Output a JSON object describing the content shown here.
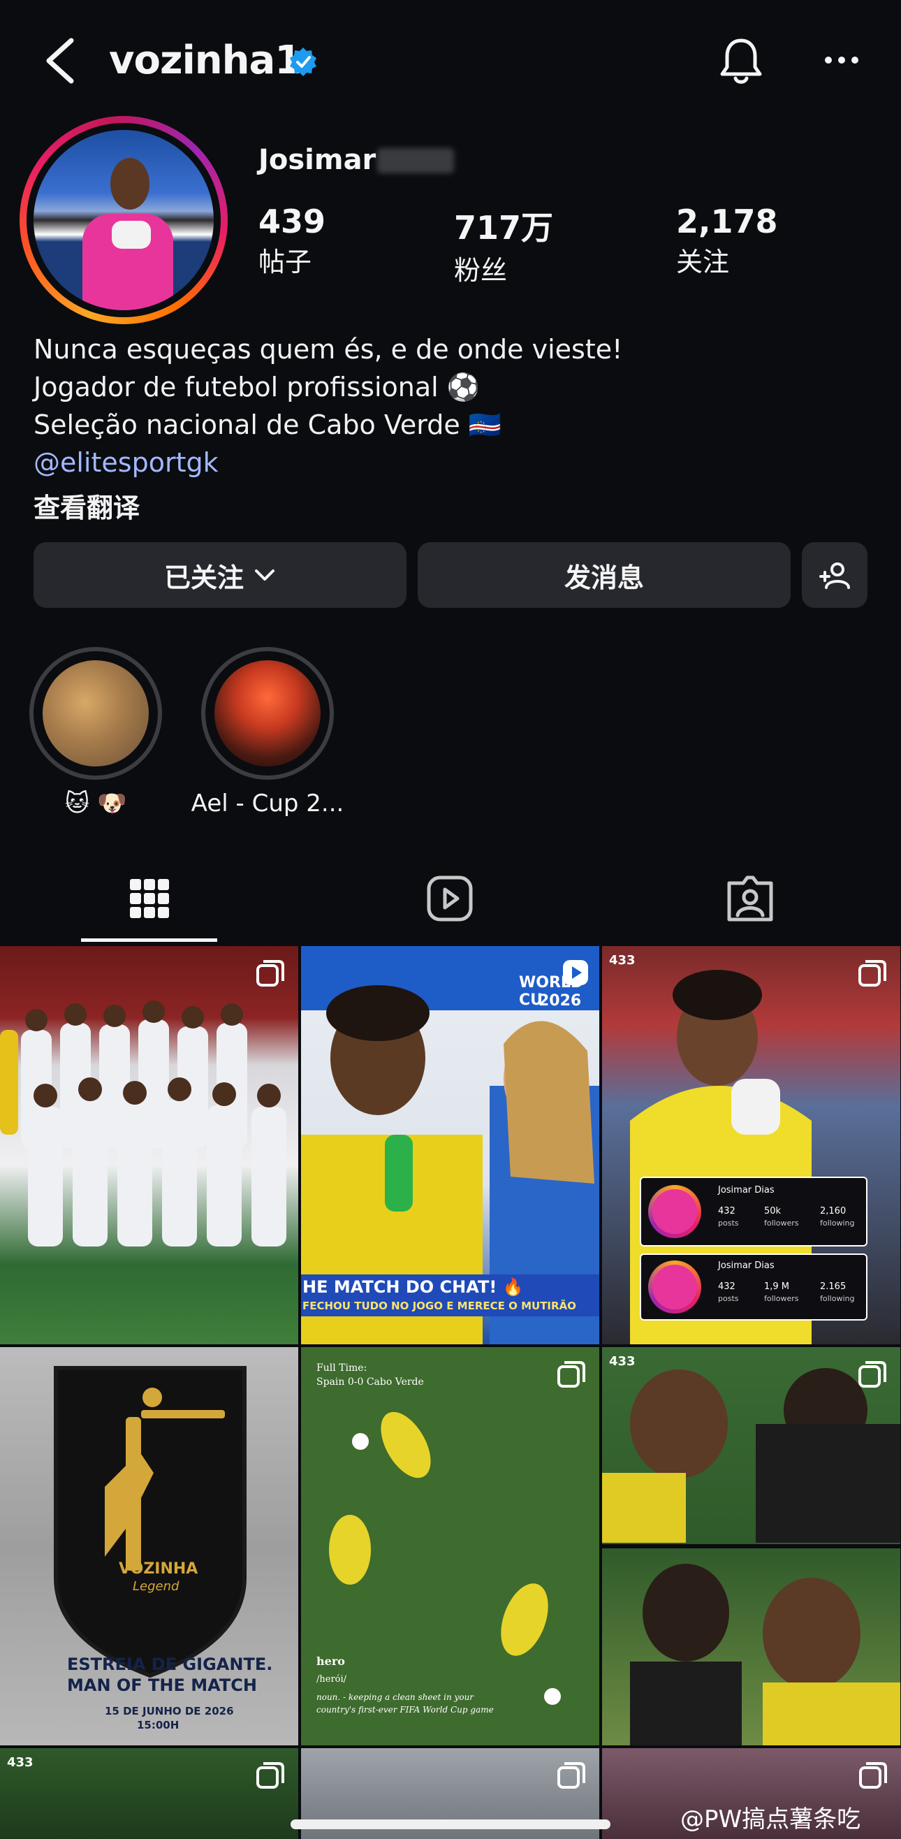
{
  "header": {
    "username": "vozinha1",
    "verified": "verified-badge-icon"
  },
  "profile": {
    "full_name": "Josimar",
    "stats": [
      {
        "value": "439",
        "label": "帖子"
      },
      {
        "value": "717万",
        "label": "粉丝"
      },
      {
        "value": "2,178",
        "label": "关注"
      }
    ],
    "bio_lines": [
      "Nunca esqueças quem és, e de onde vieste!",
      "Jogador de futebol profissional ⚽",
      "Seleção nacional de Cabo Verde 🇨🇻"
    ],
    "link": "@elitesportgk",
    "translate": "查看翻译"
  },
  "actions": {
    "follow": "已关注",
    "message": "发消息"
  },
  "highlights": [
    {
      "label": "🐱 🐶"
    },
    {
      "label": "Ael - Cup 2..."
    }
  ],
  "posts": {
    "p2": {
      "wc": "WORLD CU",
      "year": "2026",
      "banner1": "HE MATCH DO CHAT! 🔥",
      "banner2": "FECHOU TUDO NO JOGO E MERECE O MUTIRÃO"
    },
    "p3": {
      "tag": "433",
      "card1": {
        "name": "Josimar Dias",
        "a": "432",
        "al": "posts",
        "b": "50k",
        "bl": "followers",
        "c": "2,160",
        "cl": "following"
      },
      "card2": {
        "name": "Josimar Dias",
        "a": "432",
        "al": "posts",
        "b": "1,9 M",
        "bl": "followers",
        "c": "2.165",
        "cl": "following"
      }
    },
    "p4": {
      "name": "VOZINHA",
      "sub": "Legend",
      "line1": "ESTREIA DE GIGANTE.",
      "line2": "MAN OF THE MATCH",
      "date": "15 DE JUNHO DE 2026",
      "time": "15:00H"
    },
    "p5": {
      "top1": "Full Time:",
      "top2": "Spain 0-0 Cabo Verde",
      "word": "hero",
      "phon": "/herói/",
      "def1": "noun. - keeping a clean sheet in your",
      "def2": "country's first-ever FIFA World Cup game"
    },
    "p6": {
      "tag": "433"
    },
    "p7": {
      "tag": "433"
    }
  },
  "watermark": "@PW搞点薯条吃"
}
